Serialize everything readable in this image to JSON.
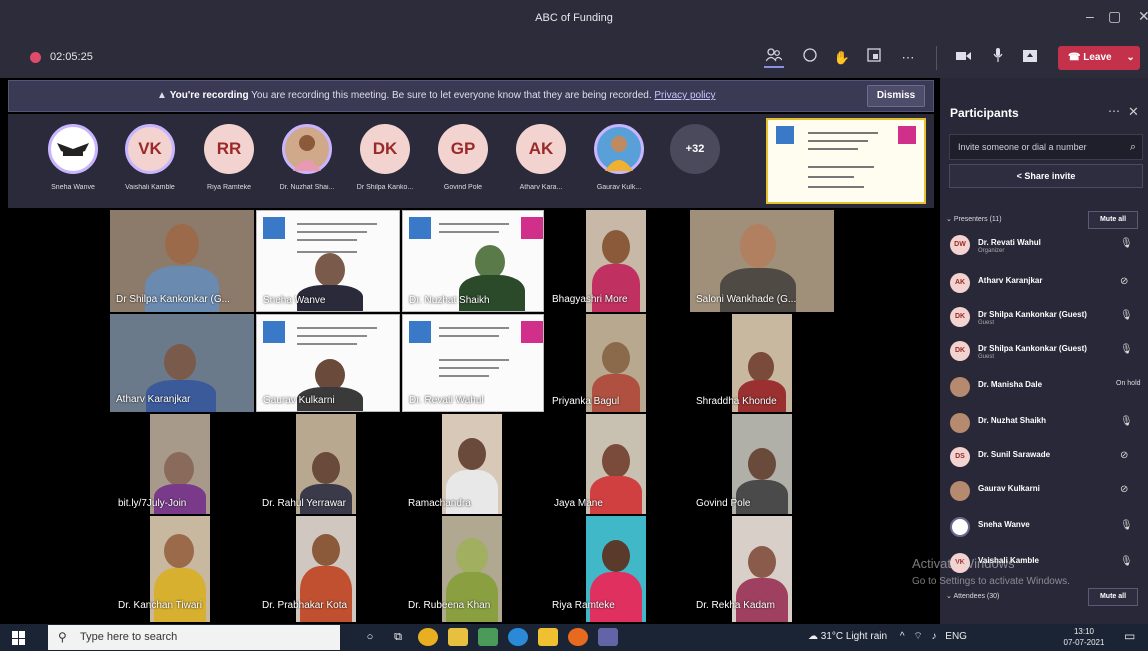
{
  "window": {
    "title": "ABC of Funding",
    "controls": [
      "–",
      "▢",
      "✕"
    ]
  },
  "toolbar": {
    "timer": "02:05:25",
    "icons": [
      "participants-icon",
      "chat-icon",
      "raise-hand-icon",
      "rooms-icon",
      "more-icon",
      "camera-icon",
      "mic-icon",
      "share-icon"
    ],
    "leave_label": "Leave"
  },
  "recording_banner": {
    "bold": "You're recording",
    "message": "You are recording this meeting. Be sure to let everyone know that they are being recorded.",
    "link": "Privacy policy",
    "dismiss_label": "Dismiss"
  },
  "avatar_strip": [
    {
      "initials": "",
      "label": "Sneha Wanve",
      "kind": "logo"
    },
    {
      "initials": "VK",
      "label": "Vaishali Kamble",
      "kind": "ring"
    },
    {
      "initials": "RR",
      "label": "Riya Ramteke",
      "kind": "plain"
    },
    {
      "initials": "",
      "label": "Dr. Nuzhat Shai...",
      "kind": "photo"
    },
    {
      "initials": "DK",
      "label": "Dr Shilpa Kanko...",
      "kind": "plain"
    },
    {
      "initials": "GP",
      "label": "Govind Pole",
      "kind": "plain"
    },
    {
      "initials": "AK",
      "label": "Atharv Kara...",
      "kind": "plain"
    },
    {
      "initials": "",
      "label": "Gaurav Kulk...",
      "kind": "photo"
    },
    {
      "initials": "+32",
      "label": "",
      "kind": "more"
    }
  ],
  "video_tiles": [
    "Dr Shilpa Kankonkar (G...",
    "Sneha Wanve",
    "Dr. Nuzhat Shaikh",
    "Bhagyashri More",
    "Saloni Wankhade (G...",
    "Atharv Karanjkar",
    "Gaurav Kulkarni",
    "Dr. Revati Wahul",
    "Priyanka Bagul",
    "Shraddha Khonde",
    "bit.ly/7July-Join",
    "Dr. Rahul Yerrawar",
    "Ramachandra",
    "Jaya Mane",
    "Govind Pole",
    "Dr. Kanchan Tiwari",
    "Dr. Prabhakar Kota",
    "Dr. Rubeena Khan",
    "Riya Ramteke",
    "Dr. Rekha Kadam"
  ],
  "participants": {
    "title": "Participants",
    "invite_placeholder": "Invite someone or dial a number",
    "share_invite_label": "Share invite",
    "presenters_label": "Presenters (11)",
    "attendees_label": "Attendees (30)",
    "mute_all_label": "Mute all",
    "list": [
      {
        "initials": "DW",
        "name": "Dr. Revati Wahul",
        "sub": "Organizer",
        "status": "mic",
        "kind": "plain"
      },
      {
        "initials": "AK",
        "name": "Atharv Karanjkar",
        "sub": "",
        "status": "mic-off",
        "kind": "plain"
      },
      {
        "initials": "DK",
        "name": "Dr Shilpa Kankonkar (Guest)",
        "sub": "Guest",
        "status": "mic",
        "kind": "plain"
      },
      {
        "initials": "DK",
        "name": "Dr Shilpa Kankonkar (Guest)",
        "sub": "Guest",
        "status": "mic",
        "kind": "plain"
      },
      {
        "initials": "",
        "name": "Dr. Manisha Dale",
        "sub": "",
        "status": "On hold",
        "kind": "ph"
      },
      {
        "initials": "",
        "name": "Dr. Nuzhat Shaikh",
        "sub": "",
        "status": "mic",
        "kind": "ph"
      },
      {
        "initials": "DS",
        "name": "Dr. Sunil Sarawade",
        "sub": "",
        "status": "mic-off",
        "kind": "plain"
      },
      {
        "initials": "",
        "name": "Gaurav Kulkarni",
        "sub": "",
        "status": "mic-off",
        "kind": "ph"
      },
      {
        "initials": "",
        "name": "Sneha Wanve",
        "sub": "",
        "status": "mic",
        "kind": "lg"
      },
      {
        "initials": "VK",
        "name": "Vaishali Kamble",
        "sub": "",
        "status": "mic",
        "kind": "plain"
      }
    ]
  },
  "watermark": {
    "line1": "Activate Windows",
    "line2": "Go to Settings to activate Windows."
  },
  "taskbar": {
    "search_placeholder": "Type here to search",
    "weather": "31°C  Light rain",
    "lang": "ENG",
    "time": "13:10",
    "date": "07-07-2021"
  }
}
